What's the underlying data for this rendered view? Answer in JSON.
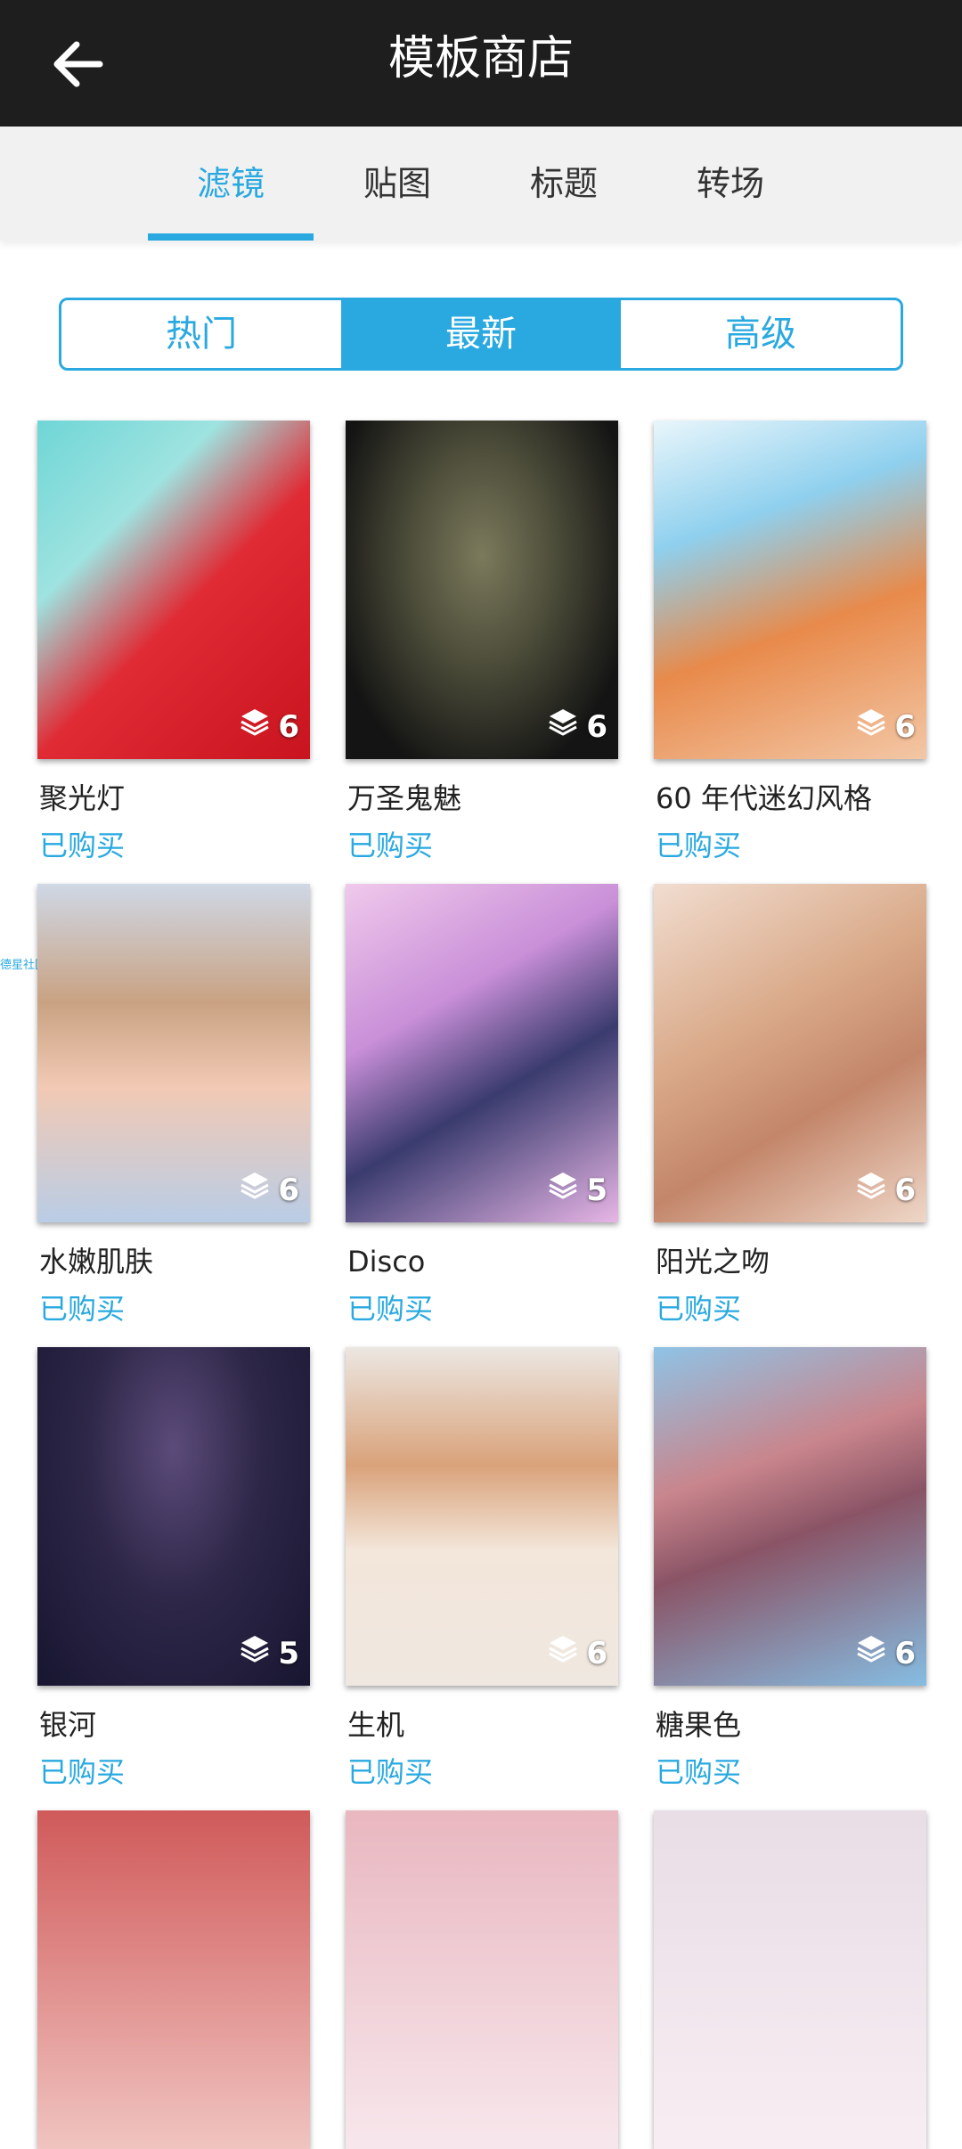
{
  "header": {
    "title": "模板商店"
  },
  "tabs": [
    {
      "label": "滤镜",
      "active": true
    },
    {
      "label": "贴图",
      "active": false
    },
    {
      "label": "标题",
      "active": false
    },
    {
      "label": "转场",
      "active": false
    }
  ],
  "segments": [
    {
      "label": "热门",
      "active": false
    },
    {
      "label": "最新",
      "active": true
    },
    {
      "label": "高级",
      "active": false
    }
  ],
  "side_tag": "德星社区",
  "items": [
    {
      "name": "聚光灯",
      "status": "已购买",
      "count": "6"
    },
    {
      "name": "万圣鬼魅",
      "status": "已购买",
      "count": "6"
    },
    {
      "name": "60 年代迷幻风格",
      "status": "已购买",
      "count": "6"
    },
    {
      "name": "水嫩肌肤",
      "status": "已购买",
      "count": "6"
    },
    {
      "name": "Disco",
      "status": "已购买",
      "count": "5"
    },
    {
      "name": "阳光之吻",
      "status": "已购买",
      "count": "6"
    },
    {
      "name": "银河",
      "status": "已购买",
      "count": "5"
    },
    {
      "name": "生机",
      "status": "已购买",
      "count": "6"
    },
    {
      "name": "糖果色",
      "status": "已购买",
      "count": "6"
    }
  ],
  "colors": {
    "accent": "#2aa9e0",
    "topbar": "#1e1e1e",
    "tabbar": "#f1f1f1"
  }
}
